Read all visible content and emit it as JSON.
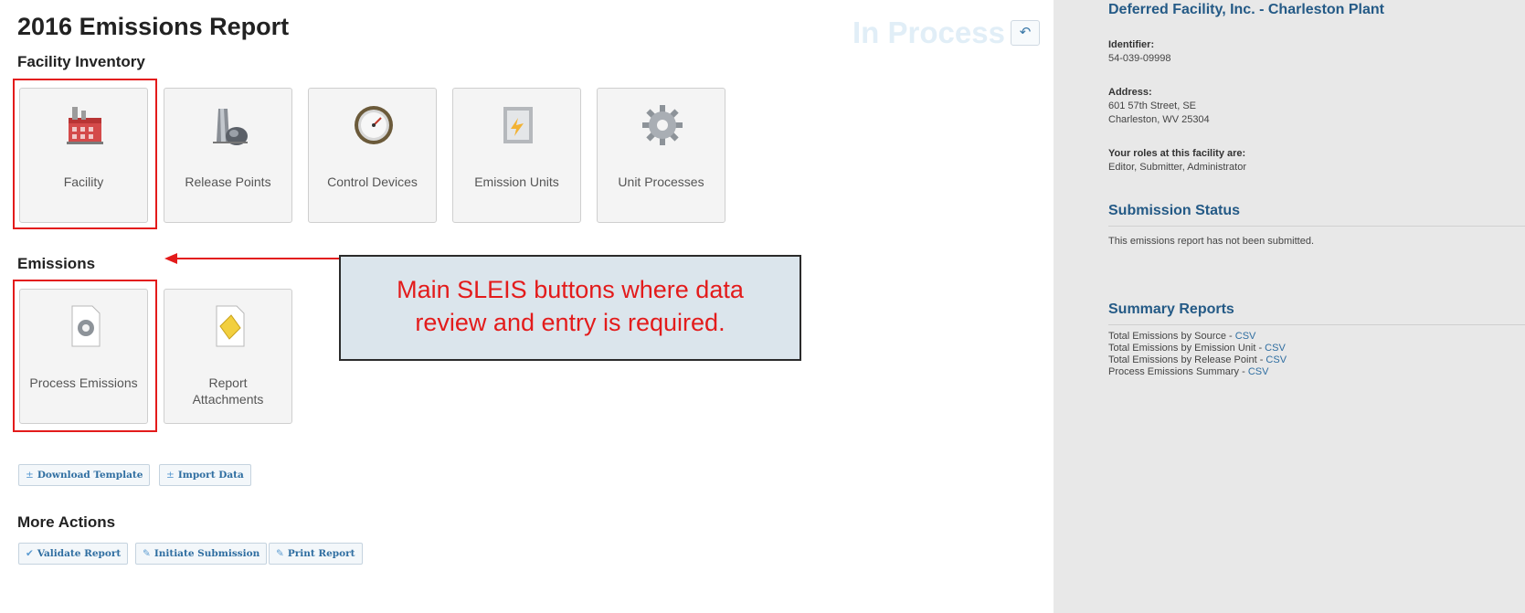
{
  "header": {
    "title": "2016 Emissions Report",
    "status": "In Process",
    "back_icon": "reply-icon"
  },
  "facility_inventory": {
    "heading": "Facility Inventory",
    "tiles": [
      {
        "label": "Facility",
        "icon": "factory-icon"
      },
      {
        "label": "Release Points",
        "icon": "stack-icon"
      },
      {
        "label": "Control Devices",
        "icon": "gauge-icon"
      },
      {
        "label": "Emission Units",
        "icon": "emission-unit-icon"
      },
      {
        "label": "Unit Processes",
        "icon": "gear-icon"
      }
    ]
  },
  "emissions": {
    "heading": "Emissions",
    "tiles": [
      {
        "label": "Process Emissions",
        "icon": "gear-document-icon"
      },
      {
        "label": "Report Attachments",
        "icon": "attachment-document-icon"
      }
    ]
  },
  "data_buttons": {
    "download": "Download Template",
    "import": "Import Data"
  },
  "more_actions": {
    "heading": "More Actions",
    "validate": "Validate Report",
    "initiate": "Initiate Submission",
    "print": "Print Report"
  },
  "callout": {
    "line1": "Main SLEIS buttons where data",
    "line2": "review and entry is required."
  },
  "sidebar": {
    "facility_name": "Deferred Facility, Inc. - Charleston Plant",
    "identifier_label": "Identifier:",
    "identifier_value": "54-039-09998",
    "address_label": "Address:",
    "address_line1": "601 57th Street, SE",
    "address_line2": "Charleston, WV 25304",
    "roles_label": "Your roles at this facility are:",
    "roles_value": "Editor, Submitter, Administrator",
    "submission_heading": "Submission Status",
    "submission_text": "This emissions report has not been submitted.",
    "summary_heading": "Summary Reports",
    "summary_reports": [
      {
        "label": "Total Emissions by Source",
        "sep": " - ",
        "link": "CSV"
      },
      {
        "label": "Total Emissions by Emission Unit",
        "sep": " - ",
        "link": "CSV"
      },
      {
        "label": "Total Emissions by Release Point",
        "sep": " - ",
        "link": "CSV"
      },
      {
        "label": "Process Emissions Summary",
        "sep": " - ",
        "link": "CSV"
      }
    ]
  },
  "colors": {
    "highlight_red": "#e31b1b",
    "heading_blue": "#245a86",
    "status_faint": "#e1eef7",
    "callout_bg": "#dbe5ec"
  }
}
